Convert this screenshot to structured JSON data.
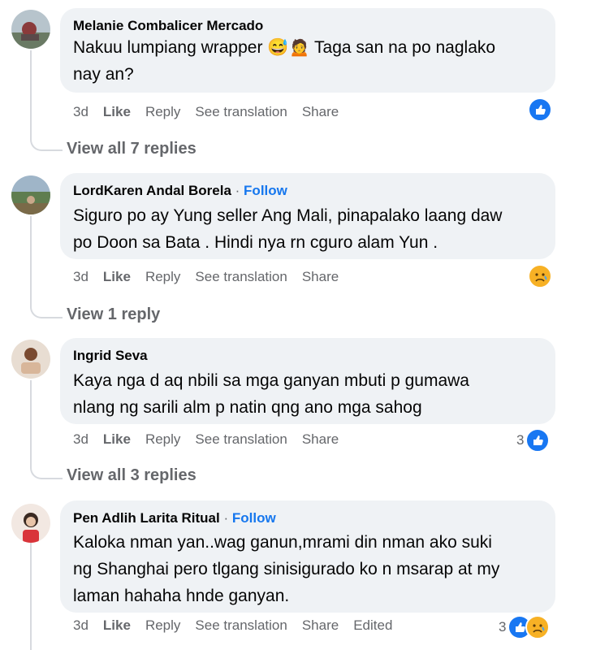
{
  "actions": {
    "time": "3d",
    "like": "Like",
    "reply": "Reply",
    "see_translation": "See translation",
    "share": "Share",
    "edited": "Edited"
  },
  "comments": [
    {
      "author": "Melanie Combalicer Mercado",
      "follow": "",
      "line1": "Nakuu lumpiang wrapper 😅🙍 Taga san na po naglako",
      "line2": "nay an?",
      "line3": "",
      "reaction_count": "",
      "replies": "View all 7 replies"
    },
    {
      "author": "LordKaren Andal Borela",
      "follow": "Follow",
      "line1": "Siguro po ay Yung seller Ang Mali, pinapalako laang daw",
      "line2": "po Doon sa Bata . Hindi nya rn cguro alam Yun .",
      "line3": "",
      "reaction_count": "",
      "replies": "View 1 reply"
    },
    {
      "author": "Ingrid Seva",
      "follow": "",
      "line1": "Kaya nga d aq nbili sa mga ganyan mbuti p gumawa",
      "line2": "nlang ng sarili alm p natin qng ano mga sahog",
      "line3": "",
      "reaction_count": "3",
      "replies": "View all 3 replies"
    },
    {
      "author": "Pen Adlih Larita Ritual",
      "follow": "Follow",
      "line1": "Kaloka nman yan..wag ganun,mrami din nman ako suki",
      "line2": "ng Shanghai pero tlgang sinisigurado ko n msarap at my",
      "line3": "laman hahaha hnde ganyan.",
      "reaction_count": "3",
      "replies": ""
    }
  ],
  "colors": {
    "bubble": "#eff2f5",
    "link": "#1677ee",
    "muted": "#65676b",
    "like": "#1877f2",
    "sad": "#f7b125"
  }
}
